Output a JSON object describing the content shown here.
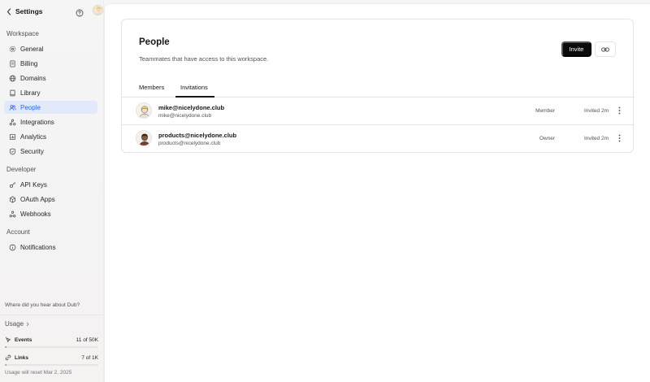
{
  "sidebar": {
    "title": "Settings",
    "sections": {
      "workspace": "Workspace",
      "developer": "Developer",
      "account": "Account"
    },
    "workspace_items": [
      {
        "label": "General",
        "icon": "gear-icon"
      },
      {
        "label": "Billing",
        "icon": "receipt-icon"
      },
      {
        "label": "Domains",
        "icon": "globe-icon"
      },
      {
        "label": "Library",
        "icon": "book-icon"
      },
      {
        "label": "People",
        "icon": "users-icon",
        "active": true
      },
      {
        "label": "Integrations",
        "icon": "integrations-icon"
      },
      {
        "label": "Analytics",
        "icon": "chart-icon"
      },
      {
        "label": "Security",
        "icon": "shield-icon"
      }
    ],
    "developer_items": [
      {
        "label": "API Keys",
        "icon": "key-icon"
      },
      {
        "label": "OAuth Apps",
        "icon": "cube-icon"
      },
      {
        "label": "Webhooks",
        "icon": "webhook-icon"
      }
    ],
    "account_items": [
      {
        "label": "Notifications",
        "icon": "info-icon"
      }
    ],
    "prompt": "Where did you hear about Dub?",
    "usage": {
      "title": "Usage",
      "events": {
        "label": "Events",
        "count": "11 of 50K",
        "fraction": 0.0002
      },
      "links": {
        "label": "Links",
        "count": "7 of 1K",
        "fraction": 0.007
      },
      "reset": "Usage will reset Mar 2, 2025"
    }
  },
  "main": {
    "title": "People",
    "subtitle": "Teammates that have access to this workspace.",
    "invite_label": "Invite",
    "tabs": [
      "Members",
      "Invitations"
    ],
    "active_tab": "Invitations",
    "invitations": [
      {
        "email": "mike@nicelydone.club",
        "email_sub": "mike@nicelydone.club",
        "role": "Member",
        "status": "Invited 2m"
      },
      {
        "email": "products@nicelydone.club",
        "email_sub": "products@nicelydone.club",
        "role": "Owner",
        "status": "Invited 2m"
      }
    ]
  },
  "colors": {
    "accent": "#2563eb",
    "active_bg": "#e2e9fb",
    "invite_button": "#0a0a0a"
  }
}
